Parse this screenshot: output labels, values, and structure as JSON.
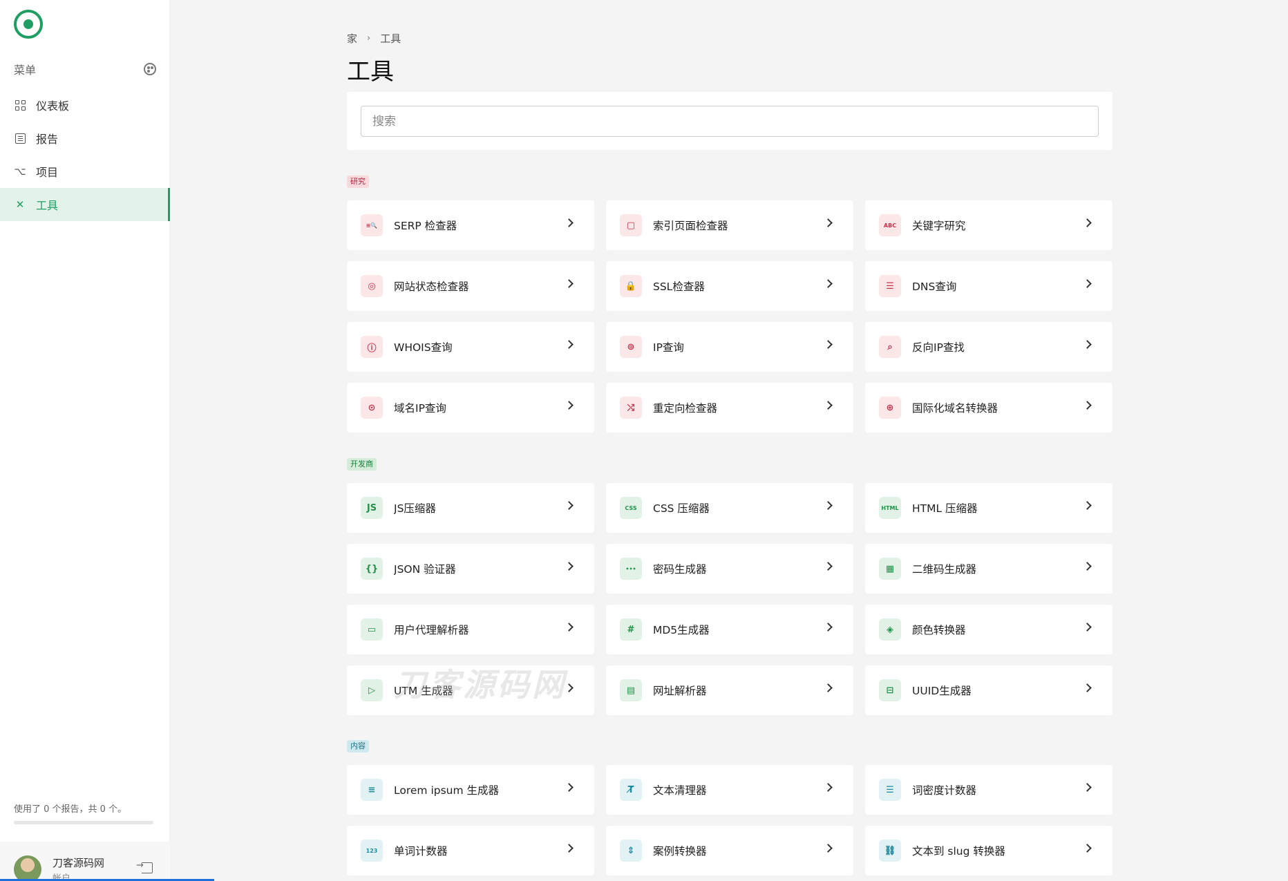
{
  "sidebar": {
    "menu_label": "菜单",
    "items": [
      {
        "label": "仪表板",
        "icon": "dashboard-icon"
      },
      {
        "label": "报告",
        "icon": "report-icon"
      },
      {
        "label": "项目",
        "icon": "project-icon"
      },
      {
        "label": "工具",
        "icon": "tools-icon",
        "active": true
      }
    ],
    "usage_text": "使用了 0 个报告，共 0 个。",
    "usage_fraction": 0,
    "account_name": "刀客源码网",
    "account_sub": "帐户"
  },
  "breadcrumb": {
    "home": "家",
    "separator": "›",
    "current": "工具"
  },
  "page_title": "工具",
  "search": {
    "placeholder": "搜索",
    "value": ""
  },
  "sections": [
    {
      "tag": "研究",
      "color": "#c8324a",
      "tools": [
        {
          "label": "SERP 检查器",
          "icon": "serp-icon",
          "glyph": "≡🔍"
        },
        {
          "label": "索引页面检查器",
          "icon": "indexed-page-icon",
          "glyph": "▢"
        },
        {
          "label": "关键字研究",
          "icon": "keyword-icon",
          "glyph": "ABC"
        },
        {
          "label": "网站状态检查器",
          "icon": "website-status-icon",
          "glyph": "◎"
        },
        {
          "label": "SSL检查器",
          "icon": "lock-icon",
          "glyph": "🔒"
        },
        {
          "label": "DNS查询",
          "icon": "dns-server-icon",
          "glyph": "☰"
        },
        {
          "label": "WHOIS查询",
          "icon": "info-icon",
          "glyph": "ⓘ"
        },
        {
          "label": "IP查询",
          "icon": "ip-search-icon",
          "glyph": "⊚"
        },
        {
          "label": "反向IP查找",
          "icon": "reverse-search-icon",
          "glyph": "⌕"
        },
        {
          "label": "域名IP查询",
          "icon": "domain-ip-icon",
          "glyph": "⊙"
        },
        {
          "label": "重定向检查器",
          "icon": "redirect-icon",
          "glyph": "⤭"
        },
        {
          "label": "国际化域名转换器",
          "icon": "globe-icon",
          "glyph": "⊕"
        }
      ]
    },
    {
      "tag": "开发商",
      "color": "#22924a",
      "tools": [
        {
          "label": "JS压缩器",
          "icon": "js-icon",
          "glyph": "JS"
        },
        {
          "label": "CSS 压缩器",
          "icon": "css-icon",
          "glyph": "CSS"
        },
        {
          "label": "HTML 压缩器",
          "icon": "html-icon",
          "glyph": "HTML"
        },
        {
          "label": "JSON 验证器",
          "icon": "braces-icon",
          "glyph": "{}"
        },
        {
          "label": "密码生成器",
          "icon": "password-icon",
          "glyph": "•••"
        },
        {
          "label": "二维码生成器",
          "icon": "qr-code-icon",
          "glyph": "▦"
        },
        {
          "label": "用户代理解析器",
          "icon": "browser-window-icon",
          "glyph": "▭"
        },
        {
          "label": "MD5生成器",
          "icon": "hash-icon",
          "glyph": "#"
        },
        {
          "label": "颜色转换器",
          "icon": "color-swatch-icon",
          "glyph": "◈"
        },
        {
          "label": "UTM 生成器",
          "icon": "tag-icon",
          "glyph": "▷"
        },
        {
          "label": "网址解析器",
          "icon": "url-parser-icon",
          "glyph": "▤"
        },
        {
          "label": "UUID生成器",
          "icon": "uuid-icon",
          "glyph": "⊟"
        }
      ]
    },
    {
      "tag": "内容",
      "color": "#1e8a9e",
      "tools": [
        {
          "label": "Lorem ipsum 生成器",
          "icon": "text-lines-icon",
          "glyph": "≡"
        },
        {
          "label": "文本清理器",
          "icon": "clear-format-icon",
          "glyph": "T̸"
        },
        {
          "label": "词密度计数器",
          "icon": "list-icon",
          "glyph": "☰"
        },
        {
          "label": "单词计数器",
          "icon": "counter-icon",
          "glyph": "123"
        },
        {
          "label": "案例转换器",
          "icon": "case-convert-icon",
          "glyph": "⇕"
        },
        {
          "label": "文本到 slug 转换器",
          "icon": "link-icon",
          "glyph": "⛓"
        }
      ]
    }
  ],
  "watermark": "刀客源码网"
}
